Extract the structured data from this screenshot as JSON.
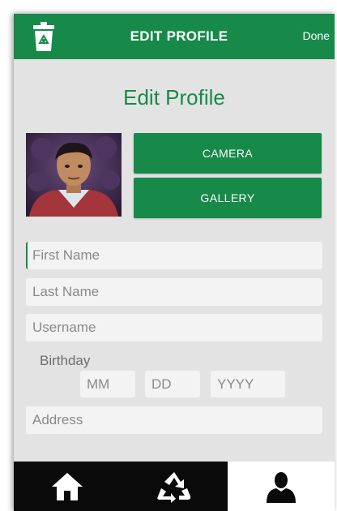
{
  "header": {
    "title": "EDIT PROFILE",
    "done_label": "Done",
    "logo_icon": "trash-bin-icon"
  },
  "page_heading": "Edit Profile",
  "buttons": {
    "camera_label": "CAMERA",
    "gallery_label": "GALLERY"
  },
  "form": {
    "first_name_placeholder": "First Name",
    "last_name_placeholder": "Last Name",
    "username_placeholder": "Username",
    "birthday_label": "Birthday",
    "month_placeholder": "MM",
    "day_placeholder": "DD",
    "year_placeholder": "YYYY",
    "address_placeholder": "Address"
  },
  "bottom_nav": {
    "items": [
      {
        "icon": "home-icon",
        "active": false
      },
      {
        "icon": "recycle-icon",
        "active": false
      },
      {
        "icon": "user-icon",
        "active": true
      }
    ]
  },
  "colors": {
    "accent": "#178a4a",
    "background": "#e3e3e3",
    "nav_background": "#0a0a0a"
  }
}
